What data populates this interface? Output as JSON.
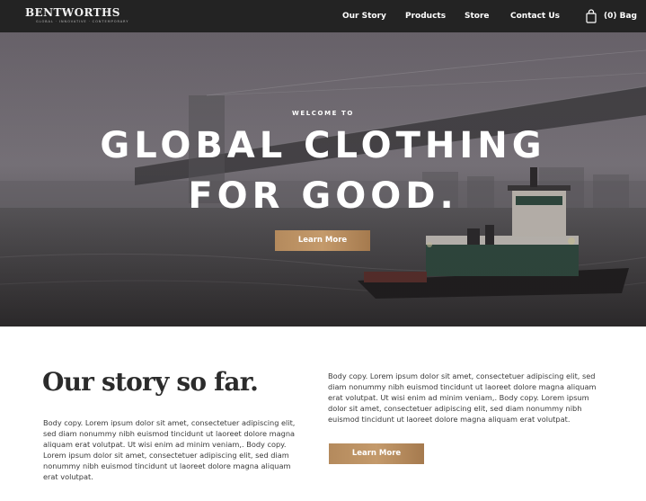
{
  "nav": {
    "brand_name": "BENTWORTHS",
    "brand_tagline": "GLOBAL · INNOVATIVE · CONTEMPORARY",
    "links": [
      "Our Story",
      "Products",
      "Store",
      "Contact Us"
    ],
    "bag_label": "(0) Bag",
    "bag_icon": "shopping-bag-icon"
  },
  "hero": {
    "kicker": "WELCOME TO",
    "title_line1": "GLOBAL CLOTHING",
    "title_line2": "FOR GOOD.",
    "button_label": "Learn More"
  },
  "story": {
    "heading": "Our story so far.",
    "left_copy": "Body copy. Lorem ipsum dolor sit amet, consectetuer adipiscing elit, sed diam nonummy nibh euismod tincidunt ut laoreet dolore magna aliquam erat volutpat. Ut wisi enim ad minim veniam,. Body copy. Lorem ipsum dolor sit amet, consectetuer adipiscing elit, sed diam nonummy nibh euismod tincidunt ut laoreet dolore magna aliquam erat volutpat.",
    "right_copy": "Body copy. Lorem ipsum dolor sit amet, consectetuer adipiscing elit, sed diam nonummy nibh euismod tincidunt ut laoreet dolore magna aliquam erat volutpat. Ut wisi enim ad minim veniam,. Body copy. Lorem ipsum dolor sit amet, consectetuer adipiscing elit, sed diam nonummy nibh euismod tincidunt ut laoreet dolore magna aliquam erat volutpat.",
    "button_label": "Learn More"
  },
  "colors": {
    "nav_bg": "#232323",
    "accent_gold": "#b48a5d",
    "text_dark": "#2b2b2b"
  }
}
